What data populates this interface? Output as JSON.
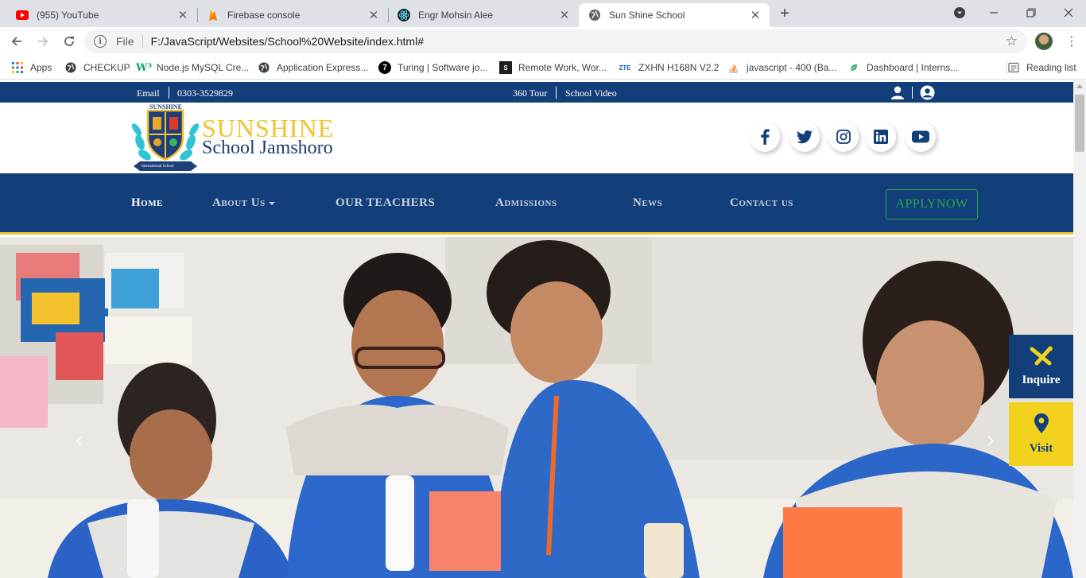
{
  "browser": {
    "tabs": [
      {
        "title": "(955) YouTube",
        "icon": "youtube-icon"
      },
      {
        "title": "Firebase console",
        "icon": "firebase-icon"
      },
      {
        "title": "Engr Mohsin Alee",
        "icon": "react-icon"
      },
      {
        "title": "Sun Shine School",
        "icon": "globe-icon"
      }
    ],
    "address": {
      "scheme": "File",
      "url": "F:/JavaScript/Websites/School%20Website/index.html#"
    },
    "bookmarks": [
      {
        "label": "Apps",
        "icon": "apps-grid-icon"
      },
      {
        "label": "CHECKUP",
        "icon": "globe-icon"
      },
      {
        "label": "Node.js MySQL Cre...",
        "icon": "w3schools-icon"
      },
      {
        "label": "Application Express...",
        "icon": "globe-icon"
      },
      {
        "label": "Turing | Software jo...",
        "icon": "turing-icon"
      },
      {
        "label": "Remote Work, Wor...",
        "icon": "remote-icon"
      },
      {
        "label": "ZXHN H168N V2.2",
        "icon": "zte-icon"
      },
      {
        "label": "javascript - 400 (Ba...",
        "icon": "stackoverflow-icon"
      },
      {
        "label": "Dashboard | Interns...",
        "icon": "internshala-icon"
      }
    ],
    "reading_list": "Reading list"
  },
  "site": {
    "topbar": {
      "email": "Email",
      "phone": "0303-3529829",
      "tour": "360 Tour",
      "video": "School Video"
    },
    "brand": {
      "line1": "SUNSHINE",
      "line2": "School Jamshoro",
      "logo_top": "SUNSHINE",
      "logo_bottom": "International School"
    },
    "social": [
      "facebook-icon",
      "twitter-icon",
      "instagram-icon",
      "linkedin-icon",
      "youtube-icon"
    ],
    "nav": {
      "home": "Home",
      "about": "About Us",
      "teachers": "OUR TEACHERS",
      "admissions": "Admissions",
      "news": "News",
      "contact": "Contact us",
      "apply": "APPLYNOW"
    },
    "side": {
      "inquire": "Inquire",
      "visit": "Visit"
    }
  },
  "colors": {
    "primary": "#123f7a",
    "accent": "#f2c230",
    "apply": "#28a745",
    "visit_bg": "#f2d21f"
  }
}
